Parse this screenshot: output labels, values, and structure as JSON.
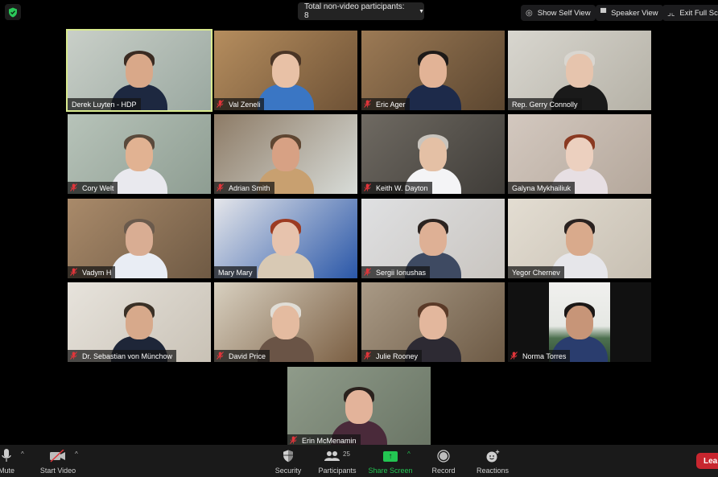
{
  "topbar": {
    "security_icon": "shield-check-icon",
    "participants_pill": "Total non-video participants: 8",
    "show_self_view": "Show Self View",
    "speaker_view": "Speaker View",
    "exit_full_screen": "Exit Full Scr"
  },
  "colors": {
    "active_speaker_border": "#d9ea8f",
    "muted_icon": "#e0353a",
    "share_green": "#23c552",
    "leave_red": "#c8262f"
  },
  "participants": [
    {
      "name": "Derek Luyten - HDP",
      "muted": false,
      "active": true
    },
    {
      "name": "Val Zeneli",
      "muted": true,
      "active": false
    },
    {
      "name": "Eric Ager",
      "muted": true,
      "active": false
    },
    {
      "name": "Rep. Gerry Connolly",
      "muted": false,
      "active": false
    },
    {
      "name": "Cory Welt",
      "muted": true,
      "active": false
    },
    {
      "name": "Adrian Smith",
      "muted": true,
      "active": false
    },
    {
      "name": "Keith W. Dayton",
      "muted": true,
      "active": false
    },
    {
      "name": "Galyna Mykhailiuk",
      "muted": false,
      "active": false
    },
    {
      "name": "Vadym H",
      "muted": true,
      "active": false
    },
    {
      "name": "Mary Mary",
      "muted": false,
      "active": false
    },
    {
      "name": "Sergii Ionushas",
      "muted": true,
      "active": false
    },
    {
      "name": "Yegor Chernev",
      "muted": false,
      "active": false
    },
    {
      "name": "Dr. Sebastian von Münchow",
      "muted": true,
      "active": false
    },
    {
      "name": "David Price",
      "muted": true,
      "active": false
    },
    {
      "name": "Julie Rooney",
      "muted": true,
      "active": false
    },
    {
      "name": "Norma Torres",
      "muted": true,
      "active": false
    },
    {
      "name": "Erin McMenamin",
      "muted": true,
      "active": false
    }
  ],
  "toolbar": {
    "mute": "Mute",
    "start_video": "Start Video",
    "security": "Security",
    "participants": "Participants",
    "participants_count": "25",
    "share_screen": "Share Screen",
    "record": "Record",
    "reactions": "Reactions",
    "leave": "Lea"
  }
}
